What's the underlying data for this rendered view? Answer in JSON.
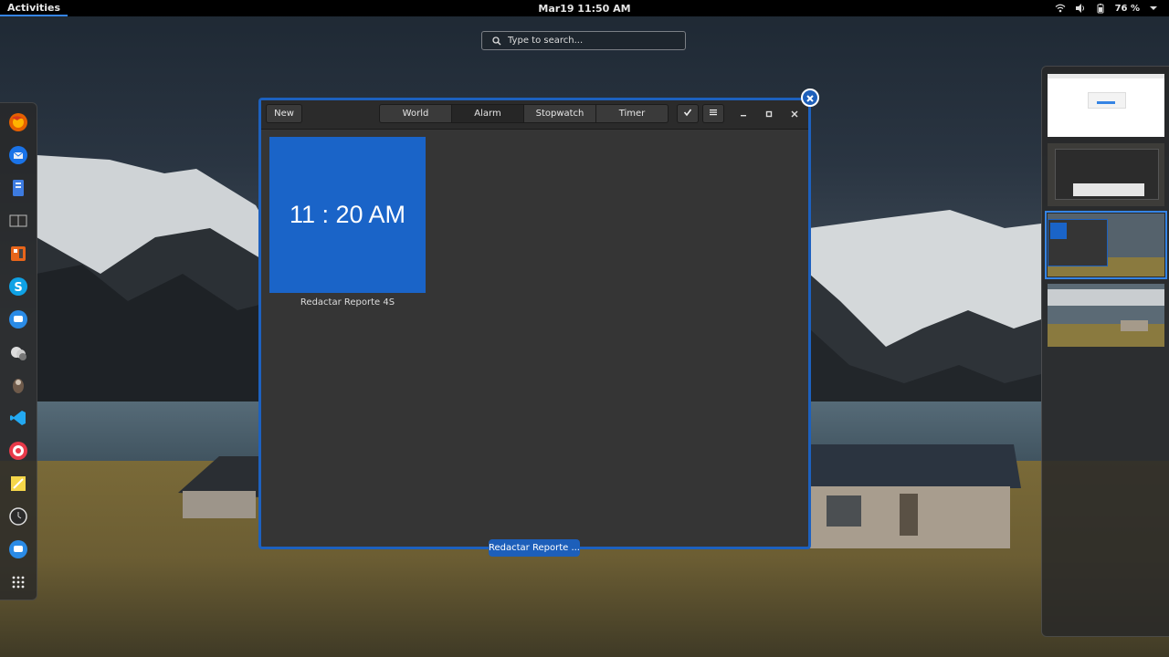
{
  "topbar": {
    "activities_label": "Activities",
    "clock_label": "Mar19  11:50 AM",
    "battery_text": "76 %",
    "icons": [
      "wifi-icon",
      "volume-icon",
      "battery-icon",
      "menu-arrow-icon"
    ]
  },
  "search": {
    "placeholder": "Type to search..."
  },
  "dash": {
    "apps": [
      "firefox-icon",
      "thunderbird-icon",
      "files-icon",
      "book-icon",
      "calculator-icon",
      "skype-icon",
      "messages-icon",
      "cloud-icon",
      "gimp-icon",
      "vscode-icon",
      "lollypop-icon",
      "notes-icon",
      "clocks-icon",
      "chat-icon",
      "show-apps-icon"
    ]
  },
  "window": {
    "new_label": "New",
    "tabs": [
      {
        "label": "World",
        "active": false
      },
      {
        "label": "Alarm",
        "active": true
      },
      {
        "label": "Stopwatch",
        "active": false
      },
      {
        "label": "Timer",
        "active": false
      }
    ],
    "alarm": {
      "time": "11 : 20 AM",
      "name": "Redactar Reporte 4S"
    },
    "caption": "Redactar Reporte ..."
  },
  "colors": {
    "accent": "#1d61bf",
    "alarm_tile": "#1a64c8",
    "window_bg": "#353535"
  }
}
